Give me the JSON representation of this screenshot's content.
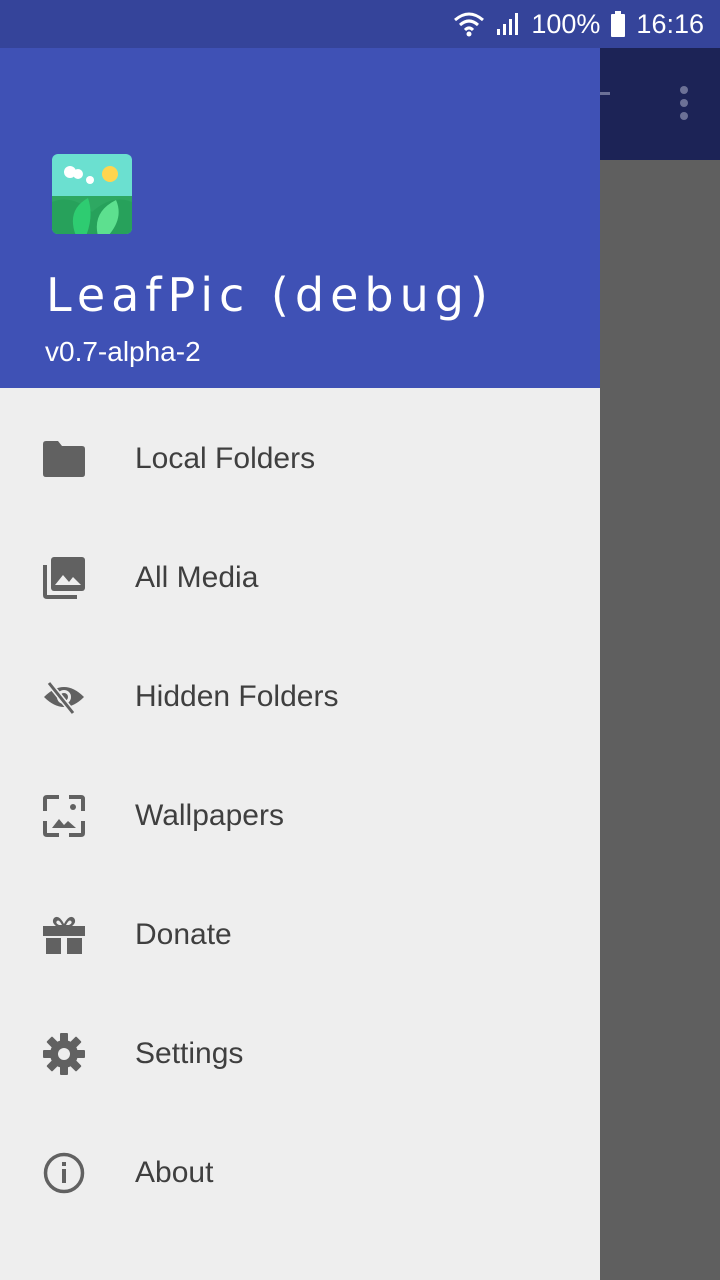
{
  "status_bar": {
    "battery": "100%",
    "time": "16:16"
  },
  "drawer": {
    "app_title": "LeafPic (debug)",
    "app_version": "v0.7-alpha-2",
    "items": [
      {
        "label": "Local Folders",
        "icon": "folder-icon"
      },
      {
        "label": "All Media",
        "icon": "photo-library-icon"
      },
      {
        "label": "Hidden Folders",
        "icon": "eye-off-icon"
      },
      {
        "label": "Wallpapers",
        "icon": "wallpaper-icon"
      },
      {
        "label": "Donate",
        "icon": "gift-icon"
      },
      {
        "label": "Settings",
        "icon": "gear-icon"
      },
      {
        "label": "About",
        "icon": "info-icon"
      }
    ]
  },
  "colors": {
    "primary": "#3f51b5",
    "status_bar": "#35449a",
    "drawer_bg": "#eeeeee",
    "icon": "#616161",
    "text": "#3f3f3f"
  }
}
